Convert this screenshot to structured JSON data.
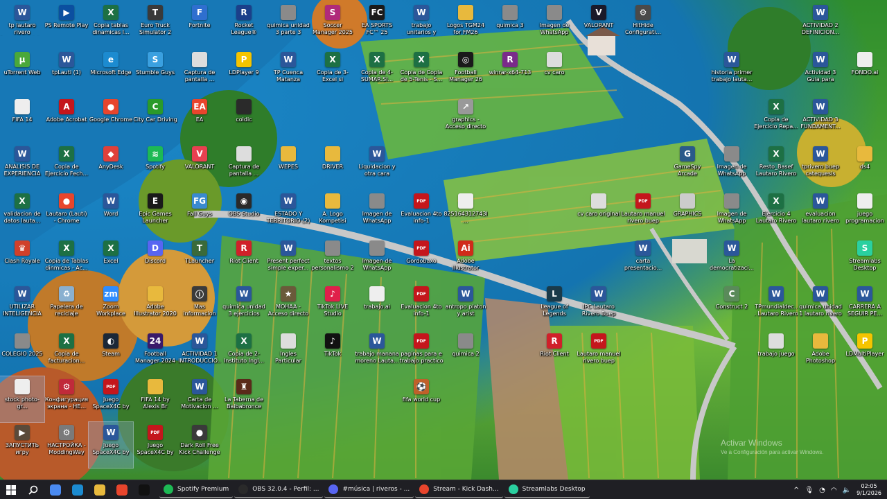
{
  "desktop": {
    "icons": [
      {
        "label": "tp lautaro rivero formacion civi...",
        "icon": "word-doc-icon",
        "color": "#2b579a",
        "glyph": "W"
      },
      {
        "label": "PS Remote Play",
        "icon": "ps-remote-play-icon",
        "color": "#0b4fa0",
        "glyph": "▶"
      },
      {
        "label": "Copia tablas dinamicas l...",
        "icon": "excel-doc-icon",
        "color": "#1d7044",
        "glyph": "X"
      },
      {
        "label": "Euro Truck Simulator 2",
        "icon": "euro-truck-icon",
        "color": "#3a3a3a",
        "glyph": "T"
      },
      {
        "label": "Fortnite",
        "icon": "fortnite-icon",
        "color": "#2f6fcf",
        "glyph": "F"
      },
      {
        "label": "Rocket League®",
        "icon": "rocket-league-icon",
        "color": "#1b3f8a",
        "glyph": "R"
      },
      {
        "label": "quimica unidad 3 parte 3 ejercicios",
        "icon": "file-icon",
        "color": "#8a8a8a",
        "glyph": ""
      },
      {
        "label": "Soccer Manager 2025",
        "icon": "soccer-manager-icon",
        "color": "#b02a7a",
        "glyph": "S"
      },
      {
        "label": "EA SPORTS FC™ 25",
        "icon": "ea-fc-icon",
        "color": "#1a1a1a",
        "glyph": "FC"
      },
      {
        "label": "trabajo unitarios y federales La...",
        "icon": "word-doc-icon",
        "color": "#2b579a",
        "glyph": "W"
      },
      {
        "label": "Logos TGM24 for FM26",
        "icon": "folder-icon",
        "color": "#e8b93d",
        "glyph": ""
      },
      {
        "label": "quimica 3",
        "icon": "file-icon",
        "color": "#8a8a8a",
        "glyph": ""
      },
      {
        "label": "Imagen de WhatsApp 202...",
        "icon": "image-file-icon",
        "color": "#8a8a8a",
        "glyph": ""
      },
      {
        "label": "VALORANT",
        "icon": "valorant-icon",
        "color": "#1a1a2a",
        "glyph": "V"
      },
      {
        "label": "HitHide Configurati...",
        "icon": "settings-file-icon",
        "color": "#4a4a4a",
        "glyph": "⚙"
      },
      {
        "label": "ACTIVIDAD 2 DEFINICION...",
        "icon": "word-doc-icon",
        "color": "#2b579a",
        "glyph": "W"
      },
      {
        "label": "uTorrent Web",
        "icon": "utorrent-icon",
        "color": "#4aa83a",
        "glyph": "µ"
      },
      {
        "label": "tpLauti (1)",
        "icon": "word-doc-icon",
        "color": "#2b579a",
        "glyph": "W"
      },
      {
        "label": "Microsoft Edge",
        "icon": "edge-icon",
        "color": "#1c8bd0",
        "glyph": "e"
      },
      {
        "label": "Stumble Guys",
        "icon": "stumble-guys-icon",
        "color": "#3aa0e0",
        "glyph": "S"
      },
      {
        "label": "Captura de pantalla ...",
        "icon": "image-file-icon",
        "color": "#dddddd",
        "glyph": ""
      },
      {
        "label": "LDPlayer 9",
        "icon": "ldplayer-icon",
        "color": "#f5c400",
        "glyph": "P"
      },
      {
        "label": "TP Cuenca Matanza Riach...",
        "icon": "word-doc-icon",
        "color": "#2b579a",
        "glyph": "W"
      },
      {
        "label": "Copia de 3- Excel si anidado Lau...",
        "icon": "excel-doc-icon",
        "color": "#1d7044",
        "glyph": "X"
      },
      {
        "label": "Copia de 4-SUMAR.SI...",
        "icon": "excel-doc-icon",
        "color": "#1d7044",
        "glyph": "X"
      },
      {
        "label": "Copia de Copia de 5-Tenis - S...",
        "icon": "excel-doc-icon",
        "color": "#1d7044",
        "glyph": "X"
      },
      {
        "label": "Football Manager 26",
        "icon": "football-manager-icon",
        "color": "#1a1a1a",
        "glyph": "◎"
      },
      {
        "label": "winrar-x64-713",
        "icon": "winrar-icon",
        "color": "#7a2a8a",
        "glyph": "R"
      },
      {
        "label": "cv caro",
        "icon": "file-icon",
        "color": "#dddddd",
        "glyph": ""
      },
      {
        "label": "historia primer trabajo lauta...",
        "icon": "word-doc-icon",
        "color": "#2b579a",
        "glyph": "W"
      },
      {
        "label": "Actividad 3 Guia para colocar u...",
        "icon": "word-doc-icon",
        "color": "#2b579a",
        "glyph": "W"
      },
      {
        "label": "FONDO.ai",
        "icon": "file-icon",
        "color": "#eeeeee",
        "glyph": ""
      },
      {
        "label": "FIFA 14",
        "icon": "file-icon",
        "color": "#eeeeee",
        "glyph": ""
      },
      {
        "label": "Adobe Acrobat",
        "icon": "acrobat-icon",
        "color": "#c4161c",
        "glyph": "A"
      },
      {
        "label": "Google Chrome",
        "icon": "chrome-icon",
        "color": "#e8452c",
        "glyph": "●"
      },
      {
        "label": "City Car Driving",
        "icon": "city-car-driving-icon",
        "color": "#2a9a2a",
        "glyph": "C"
      },
      {
        "label": "EA",
        "icon": "ea-icon",
        "color": "#e8452c",
        "glyph": "EA"
      },
      {
        "label": "coldic",
        "icon": "file-icon",
        "color": "#2a2a2a",
        "glyph": ""
      },
      {
        "label": "graphics - Acceso directo",
        "icon": "shortcut-icon",
        "color": "#999999",
        "glyph": "↗"
      },
      {
        "label": "Copia de Ejercicio Repa...",
        "icon": "excel-doc-icon",
        "color": "#1d7044",
        "glyph": "X"
      },
      {
        "label": "ACTIVIDAD 3 FUNDAMENT...",
        "icon": "word-doc-icon",
        "color": "#2b579a",
        "glyph": "W"
      },
      {
        "label": "ANÁLISIS DE EXPERIENCIA D...",
        "icon": "word-doc-icon",
        "color": "#2b579a",
        "glyph": "W"
      },
      {
        "label": "Copia de Ejercicio Fech...",
        "icon": "excel-doc-icon",
        "color": "#1d7044",
        "glyph": "X"
      },
      {
        "label": "AnyDesk",
        "icon": "anydesk-icon",
        "color": "#e0403a",
        "glyph": "◆"
      },
      {
        "label": "Spotify",
        "icon": "spotify-icon",
        "color": "#1db954",
        "glyph": "≋"
      },
      {
        "label": "VALORANT",
        "icon": "valorant-icon",
        "color": "#e84050",
        "glyph": "V"
      },
      {
        "label": "Captura de pantalla ...",
        "icon": "image-file-icon",
        "color": "#dddddd",
        "glyph": ""
      },
      {
        "label": "WEPES",
        "icon": "folder-icon",
        "color": "#e8b93d",
        "glyph": ""
      },
      {
        "label": "DRIVER",
        "icon": "folder-icon",
        "color": "#e8b93d",
        "glyph": ""
      },
      {
        "label": "Liquidacion y otra cara Lauta...",
        "icon": "word-doc-icon",
        "color": "#2b579a",
        "glyph": "W"
      },
      {
        "label": "GameSpy Arcade",
        "icon": "gamespy-icon",
        "color": "#2a5a8a",
        "glyph": "G"
      },
      {
        "label": "Imagen de WhatsApp 202...",
        "icon": "image-file-icon",
        "color": "#8a8a8a",
        "glyph": ""
      },
      {
        "label": "Resto_Basef Lautaro Rivero",
        "icon": "excel-doc-icon",
        "color": "#1d7044",
        "glyph": "X"
      },
      {
        "label": "tprivero buep catequesis",
        "icon": "word-doc-icon",
        "color": "#2b579a",
        "glyph": "W"
      },
      {
        "label": "ds4",
        "icon": "folder-icon",
        "color": "#e8b93d",
        "glyph": ""
      },
      {
        "label": "validacion de datos lauta...",
        "icon": "excel-doc-icon",
        "color": "#1d7044",
        "glyph": "X"
      },
      {
        "label": "Lautaro (Lauti) - Chrome",
        "icon": "chrome-icon",
        "color": "#e8452c",
        "glyph": "●"
      },
      {
        "label": "Word",
        "icon": "word-app-icon",
        "color": "#2b579a",
        "glyph": "W"
      },
      {
        "label": "Epic Games Launcher",
        "icon": "epic-games-icon",
        "color": "#1a1a1a",
        "glyph": "E"
      },
      {
        "label": "Fall Guys",
        "icon": "fall-guys-icon",
        "color": "#3a8ad0",
        "glyph": "FG"
      },
      {
        "label": "OBS Studio",
        "icon": "obs-icon",
        "color": "#2a2a2a",
        "glyph": "◉"
      },
      {
        "label": "ESTADO Y TERRITORIO (2)",
        "icon": "word-doc-icon",
        "color": "#2b579a",
        "glyph": "W"
      },
      {
        "label": "A. Logo Kompetisi",
        "icon": "folder-icon",
        "color": "#e8b93d",
        "glyph": ""
      },
      {
        "label": "Imagen de WhatsApp 202...",
        "icon": "image-file-icon",
        "color": "#8a8a8a",
        "glyph": ""
      },
      {
        "label": "Evaluacion 4to info-1",
        "icon": "pdf-icon",
        "color": "#c4161c",
        "glyph": "PDF"
      },
      {
        "label": "825164312743l...",
        "icon": "file-icon",
        "color": "#eeeeee",
        "glyph": ""
      },
      {
        "label": "cv caro original",
        "icon": "file-icon",
        "color": "#dddddd",
        "glyph": ""
      },
      {
        "label": "Lautaro manuel rivero buep (1...",
        "icon": "pdf-icon",
        "color": "#c4161c",
        "glyph": "PDF"
      },
      {
        "label": "GRAPHICS",
        "icon": "folder-icon",
        "color": "#cccccc",
        "glyph": ""
      },
      {
        "label": "Imagen de WhatsApp 202...",
        "icon": "image-file-icon",
        "color": "#8a8a8a",
        "glyph": ""
      },
      {
        "label": "Ejercicio 4 Lautaro Rivero",
        "icon": "excel-doc-icon",
        "color": "#1d7044",
        "glyph": "X"
      },
      {
        "label": "evaluacion lautaro rivero",
        "icon": "word-doc-icon",
        "color": "#2b579a",
        "glyph": "W"
      },
      {
        "label": "juego programacion",
        "icon": "file-icon",
        "color": "#eeeeee",
        "glyph": ""
      },
      {
        "label": "Clash Royale",
        "icon": "clash-royale-icon",
        "color": "#d0402a",
        "glyph": "♛"
      },
      {
        "label": "Copia de Tablas dinmicas - Ac...",
        "icon": "excel-doc-icon",
        "color": "#1d7044",
        "glyph": "X"
      },
      {
        "label": "Excel",
        "icon": "excel-app-icon",
        "color": "#1d7044",
        "glyph": "X"
      },
      {
        "label": "Discord",
        "icon": "discord-icon",
        "color": "#5865f2",
        "glyph": "D"
      },
      {
        "label": "TLauncher",
        "icon": "tlauncher-icon",
        "color": "#3a6a3a",
        "glyph": "T"
      },
      {
        "label": "Riot Client",
        "icon": "riot-client-icon",
        "color": "#d0202a",
        "glyph": "R"
      },
      {
        "label": "Present perfect simple exper...",
        "icon": "word-doc-icon",
        "color": "#2b579a",
        "glyph": "W"
      },
      {
        "label": "textos personalismo 2",
        "icon": "file-icon",
        "color": "#8a8a8a",
        "glyph": ""
      },
      {
        "label": "Imagen de WhatsApp 202...",
        "icon": "image-file-icon",
        "color": "#8a8a8a",
        "glyph": ""
      },
      {
        "label": "Gordobaxo",
        "icon": "pdf-icon",
        "color": "#c4161c",
        "glyph": "PDF"
      },
      {
        "label": "Adobe Illustrator 2020-20200707...",
        "icon": "illustrator-icon",
        "color": "#d02a1a",
        "glyph": "Ai"
      },
      {
        "label": "carta presentacio...",
        "icon": "word-doc-icon",
        "color": "#2b579a",
        "glyph": "W"
      },
      {
        "label": "La democratizaci...",
        "icon": "word-doc-icon",
        "color": "#2b579a",
        "glyph": "W"
      },
      {
        "label": "Streamlabs Desktop",
        "icon": "streamlabs-icon",
        "color": "#2ad0a0",
        "glyph": "S"
      },
      {
        "label": "UTILIZAR INTELIGENCIA ...",
        "icon": "word-doc-icon",
        "color": "#2b579a",
        "glyph": "W"
      },
      {
        "label": "Papelera de reciclaje",
        "icon": "recycle-bin-icon",
        "color": "#8ab0d0",
        "glyph": "♻"
      },
      {
        "label": "Zoom Workplace",
        "icon": "zoom-icon",
        "color": "#2d8cff",
        "glyph": "zm"
      },
      {
        "label": "Adobe Illustrator 2020",
        "icon": "folder-icon",
        "color": "#e8b93d",
        "glyph": ""
      },
      {
        "label": "Mas informacion sobre esta ima...",
        "icon": "info-icon",
        "color": "#3a3a3a",
        "glyph": "ⓘ"
      },
      {
        "label": "quimica unidad 3 ejercicios resuel...",
        "icon": "word-doc-icon",
        "color": "#2b579a",
        "glyph": "W"
      },
      {
        "label": "MOHAA - Acceso directo",
        "icon": "mohaa-icon",
        "color": "#6a5a3a",
        "glyph": "★"
      },
      {
        "label": "TikTok LIVE Studio",
        "icon": "tiktok-live-icon",
        "color": "#e0204a",
        "glyph": "♪"
      },
      {
        "label": "trabajo.ai",
        "icon": "file-icon",
        "color": "#eeeeee",
        "glyph": ""
      },
      {
        "label": "Evaluacion 4to info-1",
        "icon": "pdf-icon",
        "color": "#c4161c",
        "glyph": "PDF"
      },
      {
        "label": "antropo platon y arist",
        "icon": "word-doc-icon",
        "color": "#2b579a",
        "glyph": "W"
      },
      {
        "label": "League of Legends",
        "icon": "league-icon",
        "color": "#1a3a4a",
        "glyph": "L"
      },
      {
        "label": "IPC Lautaro Rivero Buep",
        "icon": "word-doc-icon",
        "color": "#2b579a",
        "glyph": "W"
      },
      {
        "label": "Construct 2",
        "icon": "construct-icon",
        "color": "#5a8a5a",
        "glyph": "C"
      },
      {
        "label": "TPmundialdec... Lautaro Rivero",
        "icon": "word-doc-icon",
        "color": "#2b579a",
        "glyph": "W"
      },
      {
        "label": "quimica unidad 1 lautaro rivero",
        "icon": "word-doc-icon",
        "color": "#2b579a",
        "glyph": "W"
      },
      {
        "label": "CARRERA A SEGUIR PE...",
        "icon": "word-doc-icon",
        "color": "#2b579a",
        "glyph": "W"
      },
      {
        "label": "COLEGIO 2025",
        "icon": "file-icon",
        "color": "#8a8a8a",
        "glyph": ""
      },
      {
        "label": "Copia de facturacion...",
        "icon": "excel-doc-icon",
        "color": "#1d7044",
        "glyph": "X"
      },
      {
        "label": "Steam",
        "icon": "steam-icon",
        "color": "#1b2838",
        "glyph": "◐"
      },
      {
        "label": "Football Manager 2024",
        "icon": "football-manager-icon",
        "color": "#3a1a6a",
        "glyph": "24"
      },
      {
        "label": "ACTIVIDAD 1 INTRODUCCIO...",
        "icon": "word-doc-icon",
        "color": "#2b579a",
        "glyph": "W"
      },
      {
        "label": "Copia de 2-Instituto Ingl...",
        "icon": "excel-doc-icon",
        "color": "#1d7044",
        "glyph": "X"
      },
      {
        "label": "Ingles Particular",
        "icon": "file-icon",
        "color": "#dddddd",
        "glyph": ""
      },
      {
        "label": "TikTok",
        "icon": "tiktok-icon",
        "color": "#111111",
        "glyph": "♪"
      },
      {
        "label": "trabajo manana moreno Lauta...",
        "icon": "word-doc-icon",
        "color": "#2b579a",
        "glyph": "W"
      },
      {
        "label": "paginas para e trabajo practico",
        "icon": "pdf-icon",
        "color": "#c4161c",
        "glyph": "PDF"
      },
      {
        "label": "quimica 2",
        "icon": "file-icon",
        "color": "#8a8a8a",
        "glyph": ""
      },
      {
        "label": "Riot Client",
        "icon": "riot-client-icon",
        "color": "#d0202a",
        "glyph": "R"
      },
      {
        "label": "Lautaro manuel rivero buep",
        "icon": "pdf-icon",
        "color": "#c4161c",
        "glyph": "PDF"
      },
      {
        "label": "trabajo juego",
        "icon": "file-icon",
        "color": "#dddddd",
        "glyph": ""
      },
      {
        "label": "Adobe Photoshop 2020",
        "icon": "folder-icon",
        "color": "#e8b93d",
        "glyph": ""
      },
      {
        "label": "LDMultiPlayer",
        "icon": "ldmultiplayer-icon",
        "color": "#f5c400",
        "glyph": "P"
      },
      {
        "label": "stock photo-gr...",
        "icon": "image-file-icon",
        "color": "#eeeeee",
        "glyph": ""
      },
      {
        "label": "Конфигурация экрана - HE...",
        "icon": "config-icon",
        "color": "#c02a3a",
        "glyph": "⚙"
      },
      {
        "label": "Juego SpaceX4C by Anibal",
        "icon": "pdf-icon",
        "color": "#c4161c",
        "glyph": "PDF"
      },
      {
        "label": "FIFA 14 by Alexis Br",
        "icon": "folder-icon",
        "color": "#e8b93d",
        "glyph": ""
      },
      {
        "label": "Carta de Motivacion ...",
        "icon": "word-doc-icon",
        "color": "#2b579a",
        "glyph": "W"
      },
      {
        "label": "La Taberna de Baibabronce",
        "icon": "game-icon",
        "color": "#5a2a1a",
        "glyph": "♜"
      },
      {
        "label": "fifa world cup",
        "icon": "game-icon",
        "color": "#c0602a",
        "glyph": "⚽"
      },
      {
        "label": "ЗАПУСТИТЬ игру",
        "icon": "launch-game-icon",
        "color": "#5a4a3a",
        "glyph": "▶"
      },
      {
        "label": "НАСТРОЙКА - ModdingWay",
        "icon": "config-icon",
        "color": "#7a7a7a",
        "glyph": "⚙"
      },
      {
        "label": "Juego SpaceX4C by Anibal",
        "icon": "word-doc-icon",
        "color": "#2b579a",
        "glyph": "W"
      },
      {
        "label": "Juego SpaceX4C by Anibal Laut...",
        "icon": "pdf-icon",
        "color": "#c4161c",
        "glyph": "PDF"
      },
      {
        "label": "Dark Roll Free Kick Challenge",
        "icon": "game-icon",
        "color": "#3a3a3a",
        "glyph": "●"
      }
    ]
  },
  "watermark": {
    "line1": "Activar Windows",
    "line2": "Ve a Configuración para activar Windows."
  },
  "taskbar": {
    "start_icon": "windows-start-icon",
    "search_icon": "search-icon",
    "pinned": [
      {
        "name": "copilot-icon",
        "color": "#4a8af0"
      },
      {
        "name": "edge-icon",
        "color": "#1c8bd0"
      },
      {
        "name": "file-explorer-icon",
        "color": "#e8b93d"
      },
      {
        "name": "chrome-icon",
        "color": "#e8452c"
      },
      {
        "name": "tiktok-icon",
        "color": "#111111"
      }
    ],
    "apps": [
      {
        "label": "Spotify Premium",
        "icon": "spotify-icon",
        "color": "#1db954"
      },
      {
        "label": "OBS 32.0.4 - Perfil: ...",
        "icon": "obs-icon",
        "color": "#2a2a2a"
      },
      {
        "label": "#música | riveros - ...",
        "icon": "discord-icon",
        "color": "#5865f2"
      },
      {
        "label": "Stream - Kick Dash...",
        "icon": "chrome-icon",
        "color": "#e8452c"
      },
      {
        "label": "Streamlabs Desktop",
        "icon": "streamlabs-icon",
        "color": "#2ad0a0"
      }
    ],
    "tray": {
      "chevron": "^",
      "time": "02:05",
      "date": "9/1/2026"
    }
  }
}
